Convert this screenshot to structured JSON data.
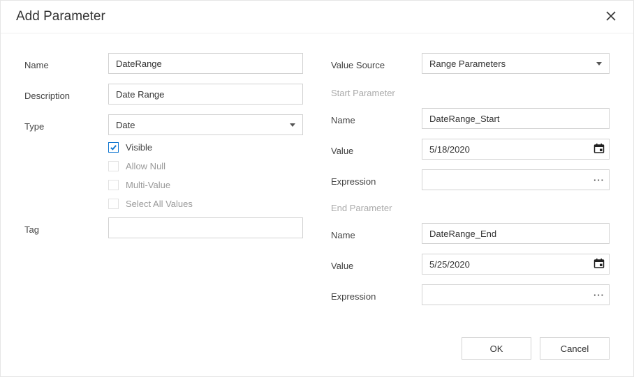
{
  "dialog": {
    "title": "Add Parameter"
  },
  "left": {
    "name_label": "Name",
    "name_value": "DateRange",
    "description_label": "Description",
    "description_value": "Date Range",
    "type_label": "Type",
    "type_value": "Date",
    "checkboxes": {
      "visible_label": "Visible",
      "visible_checked": true,
      "allow_null_label": "Allow Null",
      "allow_null_checked": false,
      "multi_value_label": "Multi-Value",
      "multi_value_checked": false,
      "select_all_label": "Select All Values",
      "select_all_checked": false
    },
    "tag_label": "Tag",
    "tag_value": ""
  },
  "right": {
    "value_source_label": "Value Source",
    "value_source_value": "Range Parameters",
    "start_section": "Start Parameter",
    "start_name_label": "Name",
    "start_name_value": "DateRange_Start",
    "start_value_label": "Value",
    "start_value_value": "5/18/2020",
    "start_expr_label": "Expression",
    "start_expr_value": "",
    "end_section": "End Parameter",
    "end_name_label": "Name",
    "end_name_value": "DateRange_End",
    "end_value_label": "Value",
    "end_value_value": "5/25/2020",
    "end_expr_label": "Expression",
    "end_expr_value": ""
  },
  "buttons": {
    "ok": "OK",
    "cancel": "Cancel"
  }
}
